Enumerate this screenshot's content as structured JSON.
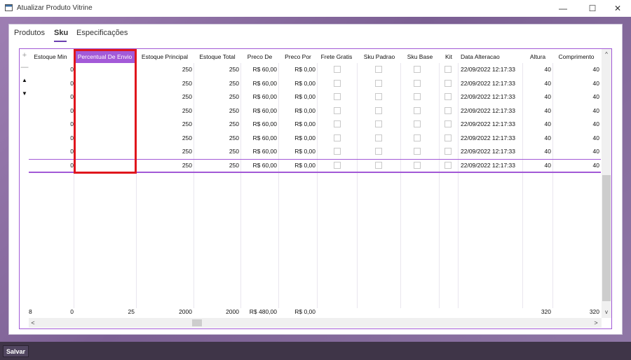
{
  "window": {
    "title": "Atualizar Produto Vitrine",
    "controls": [
      "—",
      "☐",
      "✕"
    ]
  },
  "tabs": [
    {
      "label": "Produtos",
      "active": false
    },
    {
      "label": "Sku",
      "active": true
    },
    {
      "label": "Especificações",
      "active": false
    }
  ],
  "grid": {
    "side_controls": {
      "add": "+",
      "remove": "—",
      "up": "▲",
      "down": "▼"
    },
    "columns": [
      "Estoque Min",
      "Percentual De Envio",
      "Estoque Principal",
      "Estoque Total",
      "Preco De",
      "Preco Por",
      "Frete Gratis",
      "Sku Padrao",
      "Sku Base",
      "Kit",
      "Data Alteracao",
      "Altura",
      "Comprimento"
    ],
    "selected_column": "Percentual De Envio",
    "rows": [
      {
        "estoque_min": "0",
        "percentual": "",
        "estoque_principal": "250",
        "estoque_total": "250",
        "preco_de": "R$ 60,00",
        "preco_por": "R$ 0,00",
        "frete_gratis": false,
        "sku_padrao": false,
        "sku_base": false,
        "kit": false,
        "data": "22/09/2022 12:17:33",
        "altura": "40",
        "comprimento": "40"
      },
      {
        "estoque_min": "0",
        "percentual": "",
        "estoque_principal": "250",
        "estoque_total": "250",
        "preco_de": "R$ 60,00",
        "preco_por": "R$ 0,00",
        "frete_gratis": false,
        "sku_padrao": false,
        "sku_base": false,
        "kit": false,
        "data": "22/09/2022 12:17:33",
        "altura": "40",
        "comprimento": "40"
      },
      {
        "estoque_min": "0",
        "percentual": "",
        "estoque_principal": "250",
        "estoque_total": "250",
        "preco_de": "R$ 60,00",
        "preco_por": "R$ 0,00",
        "frete_gratis": false,
        "sku_padrao": false,
        "sku_base": false,
        "kit": false,
        "data": "22/09/2022 12:17:33",
        "altura": "40",
        "comprimento": "40"
      },
      {
        "estoque_min": "0",
        "percentual": "",
        "estoque_principal": "250",
        "estoque_total": "250",
        "preco_de": "R$ 60,00",
        "preco_por": "R$ 0,00",
        "frete_gratis": false,
        "sku_padrao": false,
        "sku_base": false,
        "kit": false,
        "data": "22/09/2022 12:17:33",
        "altura": "40",
        "comprimento": "40"
      },
      {
        "estoque_min": "0",
        "percentual": "",
        "estoque_principal": "250",
        "estoque_total": "250",
        "preco_de": "R$ 60,00",
        "preco_por": "R$ 0,00",
        "frete_gratis": false,
        "sku_padrao": false,
        "sku_base": false,
        "kit": false,
        "data": "22/09/2022 12:17:33",
        "altura": "40",
        "comprimento": "40"
      },
      {
        "estoque_min": "0",
        "percentual": "",
        "estoque_principal": "250",
        "estoque_total": "250",
        "preco_de": "R$ 60,00",
        "preco_por": "R$ 0,00",
        "frete_gratis": false,
        "sku_padrao": false,
        "sku_base": false,
        "kit": false,
        "data": "22/09/2022 12:17:33",
        "altura": "40",
        "comprimento": "40"
      },
      {
        "estoque_min": "0",
        "percentual": "",
        "estoque_principal": "250",
        "estoque_total": "250",
        "preco_de": "R$ 60,00",
        "preco_por": "R$ 0,00",
        "frete_gratis": false,
        "sku_padrao": false,
        "sku_base": false,
        "kit": false,
        "data": "22/09/2022 12:17:33",
        "altura": "40",
        "comprimento": "40"
      },
      {
        "estoque_min": "0",
        "percentual": "",
        "estoque_principal": "250",
        "estoque_total": "250",
        "preco_de": "R$ 60,00",
        "preco_por": "R$ 0,00",
        "frete_gratis": false,
        "sku_padrao": false,
        "sku_base": false,
        "kit": false,
        "data": "22/09/2022 12:17:33",
        "altura": "40",
        "comprimento": "40"
      }
    ],
    "footer": {
      "count": "8",
      "estoque_min": "0",
      "percentual": "25",
      "estoque_principal": "2000",
      "estoque_total": "2000",
      "preco_de": "R$ 480,00",
      "preco_por": "R$ 0,00",
      "altura": "320",
      "comprimento": "320"
    },
    "scroll": {
      "up": "^",
      "down": "v",
      "left": "<",
      "right": ">"
    }
  },
  "actions": {
    "save_label": "Salvar"
  },
  "colors": {
    "accent": "#a35ad8",
    "highlight": "#e0161d",
    "bottombar": "#3f3548"
  }
}
